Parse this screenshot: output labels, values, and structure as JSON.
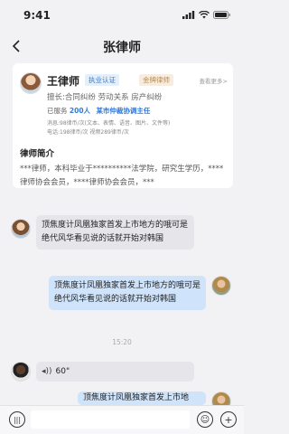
{
  "status": {
    "time": "9:41"
  },
  "nav": {
    "title": "张律师"
  },
  "lawyer": {
    "name": "王律师",
    "badges": [
      "执业认证",
      "金牌律师"
    ],
    "more": "查看更多>",
    "specialty": "擅长:合同纠纷  劳动关系  房产纠纷",
    "served_prefix": "已服务",
    "served_count": "200人",
    "served_org": "某市仲裁协调主任",
    "price_lines": [
      "消息:98律币/次(文本、表情、语音、图片、文件等)",
      "电话:198律币/次  视频289律币/次"
    ],
    "intro_title": "律师简介",
    "intro_text": "***律师，本科毕业于**********法学院，研究生学历，****律师协会会员，****律师协会会员，***"
  },
  "messages": [
    {
      "side": "left",
      "text": "顶焦度计凤凰独家首发上市地方的哦可是绝代风华看见说的话就开始对韩国"
    },
    {
      "side": "right",
      "text": "顶焦度计凤凰独家首发上市地方的哦可是绝代风华看见说的话就开始对韩国"
    },
    {
      "side": "time",
      "text": "15:20"
    },
    {
      "side": "left-voice",
      "text": "60\""
    },
    {
      "side": "right",
      "text": "顶焦度计凤凰独家首发上市地"
    }
  ],
  "icons": [
    "back-icon",
    "signal-icon",
    "wifi-icon",
    "battery-icon",
    "voice-wave-icon",
    "emoji-icon",
    "plus-icon"
  ]
}
